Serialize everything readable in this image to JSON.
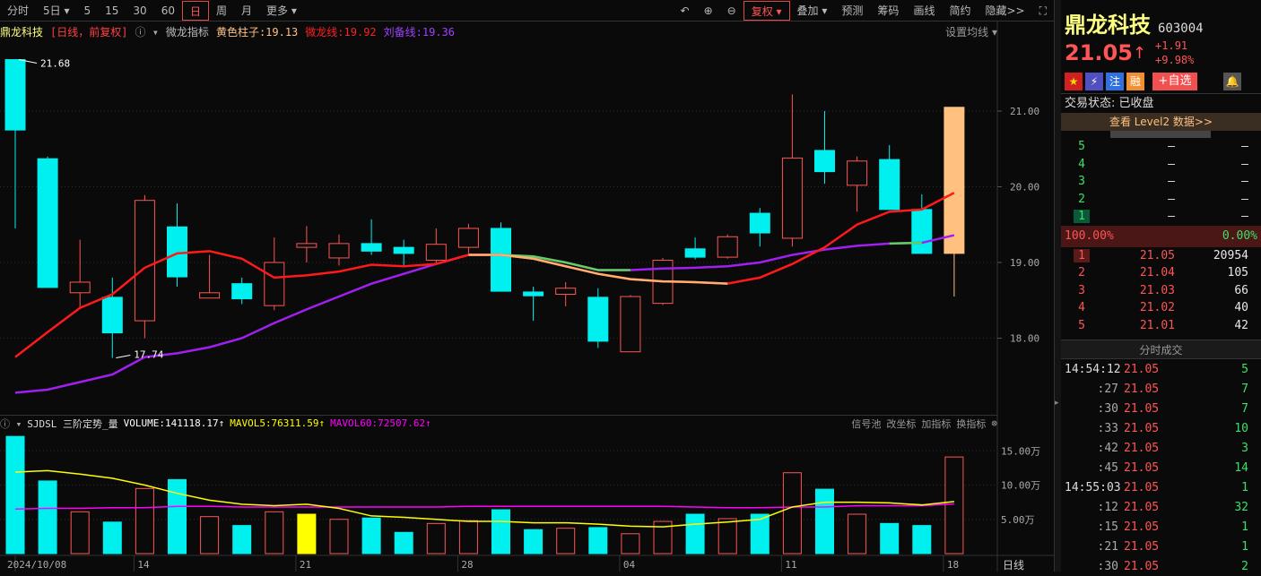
{
  "toolbar": {
    "items": [
      "分时",
      "5日",
      "5",
      "15",
      "30",
      "60",
      "日",
      "周",
      "月",
      "更多"
    ],
    "active": "日",
    "right_items": [
      "复权",
      "叠加",
      "预测",
      "筹码",
      "画线",
      "简约",
      "隐藏>>"
    ]
  },
  "info": {
    "name": "鼎龙科技",
    "period": "[日线，前复权]",
    "indicator": "微龙指标",
    "yellow": "黄色柱子:19.13",
    "weilong": "微龙线:19.92",
    "liubei": "刘备线:19.36",
    "setting": "设置均线"
  },
  "colors": {
    "up": "#ff5555",
    "down": "#00f0f0",
    "weilong": "#ff1a1a",
    "liubei": "#a020f0",
    "ma5": "#ffff00",
    "ma60": "#ff00ff",
    "highlight": "#ffc080"
  },
  "chart_data": [
    {
      "type": "candlestick",
      "title": "鼎龙科技 日线 前复权",
      "y_ticks": [
        "21.00",
        "20.00",
        "19.00",
        "18.00"
      ],
      "ylim": [
        17.0,
        22.2
      ],
      "annotations": {
        "high": "21.68",
        "low": "17.74"
      },
      "x_labels": [
        {
          "i": 0,
          "text": "2024/10/08"
        },
        {
          "i": 4,
          "text": "14"
        },
        {
          "i": 9,
          "text": "21"
        },
        {
          "i": 14,
          "text": "28"
        },
        {
          "i": 19,
          "text": "04"
        },
        {
          "i": 24,
          "text": "11"
        },
        {
          "i": 29,
          "text": "18"
        }
      ],
      "ohlc": [
        [
          21.68,
          20.75,
          21.68,
          19.45
        ],
        [
          20.37,
          18.67,
          20.4,
          18.67
        ],
        [
          18.6,
          18.74,
          19.3,
          18.4
        ],
        [
          18.54,
          18.07,
          18.8,
          17.74
        ],
        [
          18.23,
          19.82,
          19.89,
          18.0
        ],
        [
          19.47,
          18.81,
          19.78,
          18.68
        ],
        [
          18.53,
          18.6,
          19.1,
          18.53
        ],
        [
          18.72,
          18.52,
          18.8,
          18.45
        ],
        [
          18.43,
          19.0,
          19.33,
          18.37
        ],
        [
          19.2,
          19.25,
          19.48,
          19.0
        ],
        [
          19.06,
          19.25,
          19.37,
          18.96
        ],
        [
          19.25,
          19.15,
          19.57,
          19.1
        ],
        [
          19.2,
          19.12,
          19.3,
          18.96
        ],
        [
          19.03,
          19.24,
          19.45,
          18.99
        ],
        [
          19.2,
          19.45,
          19.51,
          19.12
        ],
        [
          19.45,
          18.62,
          19.53,
          18.62
        ],
        [
          18.61,
          18.56,
          18.68,
          18.23
        ],
        [
          18.58,
          18.66,
          18.74,
          18.42
        ],
        [
          18.54,
          17.96,
          18.66,
          17.87
        ],
        [
          17.82,
          18.55,
          18.57,
          17.82
        ],
        [
          18.46,
          19.03,
          19.06,
          18.44
        ],
        [
          19.18,
          19.07,
          19.33,
          19.04
        ],
        [
          19.07,
          19.34,
          19.37,
          19.05
        ],
        [
          19.65,
          19.39,
          19.72,
          19.21
        ],
        [
          19.32,
          20.38,
          21.22,
          19.21
        ],
        [
          20.48,
          20.2,
          21.0,
          20.04
        ],
        [
          20.02,
          20.34,
          20.4,
          19.67
        ],
        [
          20.36,
          19.7,
          20.55,
          19.7
        ],
        [
          19.7,
          19.12,
          19.9,
          19.12
        ],
        [
          19.12,
          21.05,
          21.05,
          18.55
        ]
      ],
      "weilong": [
        17.75,
        18.08,
        18.4,
        18.58,
        18.93,
        19.12,
        19.15,
        19.05,
        18.8,
        18.83,
        18.88,
        18.97,
        18.95,
        18.98,
        19.1,
        19.1,
        19.05,
        18.95,
        18.85,
        18.78,
        18.75,
        18.74,
        18.72,
        18.8,
        18.98,
        19.2,
        19.5,
        19.67,
        19.7,
        19.92
      ],
      "liubei": [
        17.28,
        17.32,
        17.42,
        17.52,
        17.75,
        17.8,
        17.88,
        18.0,
        18.2,
        18.38,
        18.55,
        18.72,
        18.85,
        18.98,
        19.1,
        19.1,
        19.08,
        19.0,
        18.9,
        18.9,
        18.92,
        18.93,
        18.95,
        19.0,
        19.1,
        19.17,
        19.22,
        19.25,
        19.26,
        19.36
      ]
    },
    {
      "type": "bar",
      "title": "SJDSL 三阶定势_量",
      "unit": "万",
      "y_ticks": [
        "15.00万",
        "10.00万",
        "5.00万"
      ],
      "volume": [
        17.1,
        10.6,
        6.1,
        4.6,
        9.5,
        10.8,
        5.4,
        4.1,
        6.1,
        5.75,
        5.0,
        5.2,
        3.1,
        4.4,
        4.8,
        6.4,
        3.5,
        3.7,
        3.8,
        2.9,
        4.7,
        5.75,
        5.1,
        5.75,
        11.8,
        9.4,
        5.75,
        4.4,
        4.1,
        14.1
      ],
      "mavol5": [
        11.9,
        12.1,
        11.6,
        11.0,
        10.0,
        8.8,
        7.8,
        7.2,
        7.0,
        7.2,
        6.6,
        5.5,
        5.3,
        5.0,
        4.7,
        4.7,
        4.5,
        4.5,
        4.3,
        4.0,
        3.9,
        4.3,
        4.6,
        5.0,
        6.8,
        7.5,
        7.5,
        7.4,
        7.1,
        7.6
      ],
      "mavol60": [
        6.5,
        6.6,
        6.6,
        6.7,
        6.7,
        6.9,
        6.9,
        6.8,
        6.8,
        6.8,
        6.8,
        6.8,
        6.8,
        6.8,
        6.9,
        6.9,
        6.9,
        6.9,
        6.9,
        6.9,
        6.9,
        6.8,
        6.7,
        6.7,
        6.8,
        6.8,
        7.0,
        7.0,
        7.0,
        7.25
      ]
    }
  ],
  "volinfo": {
    "name": "SJDSL 三阶定势_量",
    "volume": "VOLUME:141118.17↑",
    "ma5": "MAVOL5:76311.59↑",
    "ma60": "MAVOL60:72507.62↑",
    "buttons": [
      "信号池",
      "改坐标",
      "加指标",
      "换指标"
    ]
  },
  "period_label": "日线",
  "right": {
    "name": "鼎龙科技",
    "code": "603004",
    "price": "21.05",
    "arrow": "↑",
    "change": "+1.91",
    "pct": "+9.98%",
    "badges": [
      "★",
      "⚡",
      "注",
      "融",
      "+自选"
    ],
    "status": "交易状态: 已收盘",
    "level2": "查看 Level2 数据>>",
    "sell": [
      {
        "n": "5",
        "p": "—",
        "v": "—"
      },
      {
        "n": "4",
        "p": "—",
        "v": "—"
      },
      {
        "n": "3",
        "p": "—",
        "v": "—"
      },
      {
        "n": "2",
        "p": "—",
        "v": "—"
      },
      {
        "n": "1",
        "p": "—",
        "v": "—"
      }
    ],
    "ratio_left": "100.00%",
    "ratio_right": "0.00%",
    "buy": [
      {
        "n": "1",
        "p": "21.05",
        "v": "20954"
      },
      {
        "n": "2",
        "p": "21.04",
        "v": "105"
      },
      {
        "n": "3",
        "p": "21.03",
        "v": "66"
      },
      {
        "n": "4",
        "p": "21.02",
        "v": "40"
      },
      {
        "n": "5",
        "p": "21.01",
        "v": "42"
      }
    ],
    "ticks_title": "分时成交",
    "ticks": [
      {
        "t": "14:54:12",
        "p": "21.05",
        "v": "5"
      },
      {
        "t": ":27",
        "p": "21.05",
        "v": "7"
      },
      {
        "t": ":30",
        "p": "21.05",
        "v": "7"
      },
      {
        "t": ":33",
        "p": "21.05",
        "v": "10"
      },
      {
        "t": ":42",
        "p": "21.05",
        "v": "3"
      },
      {
        "t": ":45",
        "p": "21.05",
        "v": "14"
      },
      {
        "t": "14:55:03",
        "p": "21.05",
        "v": "1"
      },
      {
        "t": ":12",
        "p": "21.05",
        "v": "32"
      },
      {
        "t": ":15",
        "p": "21.05",
        "v": "1"
      },
      {
        "t": ":21",
        "p": "21.05",
        "v": "1"
      },
      {
        "t": ":30",
        "p": "21.05",
        "v": "2"
      }
    ]
  }
}
